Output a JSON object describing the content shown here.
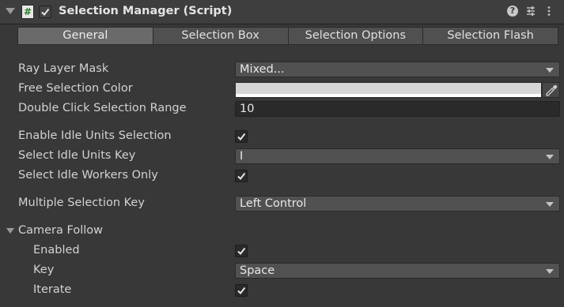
{
  "header": {
    "title": "Selection Manager (Script)",
    "script_icon_glyph": "#",
    "enabled": true,
    "help_icon_glyph": "?"
  },
  "tabs": [
    {
      "label": "General",
      "active": true
    },
    {
      "label": "Selection Box",
      "active": false
    },
    {
      "label": "Selection Options",
      "active": false
    },
    {
      "label": "Selection Flash",
      "active": false
    }
  ],
  "fields": {
    "ray_layer_mask": {
      "label": "Ray Layer Mask",
      "value": "Mixed..."
    },
    "free_selection_color": {
      "label": "Free Selection Color",
      "color": "#d6d6d6"
    },
    "double_click_range": {
      "label": "Double Click Selection Range",
      "value": "10"
    },
    "enable_idle_units": {
      "label": "Enable Idle Units Selection",
      "checked": true
    },
    "select_idle_units_key": {
      "label": "Select Idle Units Key",
      "value": "I"
    },
    "select_idle_workers_only": {
      "label": "Select Idle Workers Only",
      "checked": true
    },
    "multiple_selection_key": {
      "label": "Multiple Selection Key",
      "value": "Left Control"
    }
  },
  "camera_follow": {
    "label": "Camera Follow",
    "enabled": {
      "label": "Enabled",
      "checked": true
    },
    "key": {
      "label": "Key",
      "value": "Space"
    },
    "iterate": {
      "label": "Iterate",
      "checked": true
    }
  }
}
